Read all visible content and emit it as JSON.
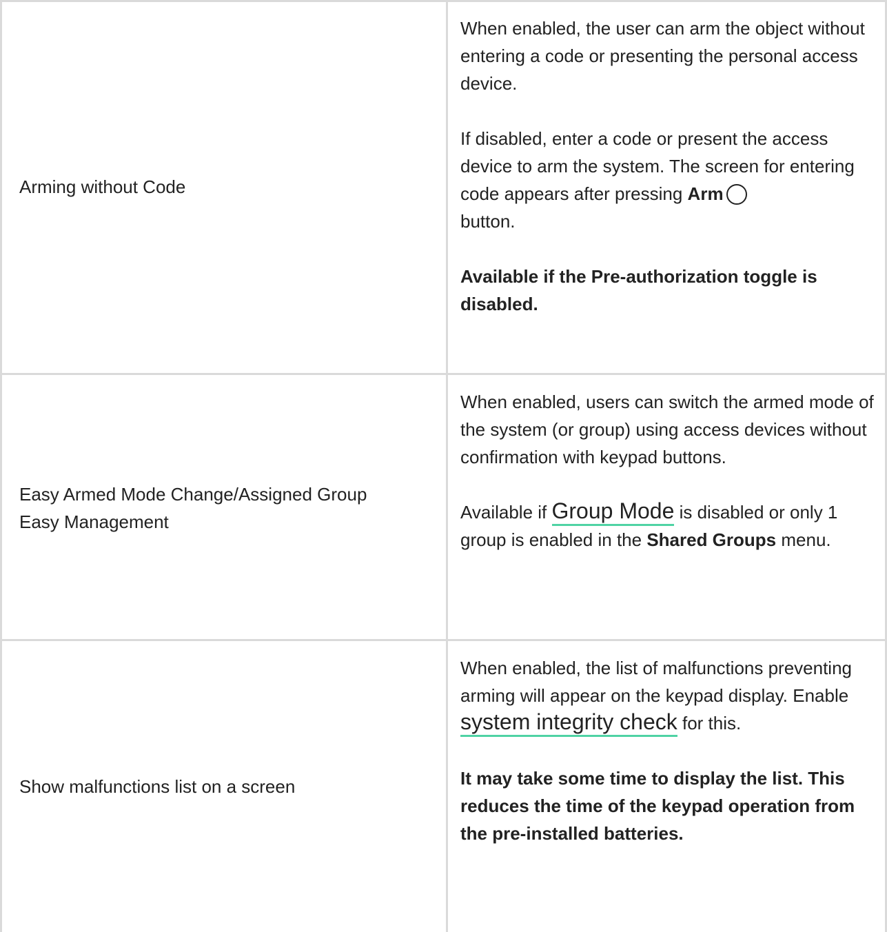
{
  "rows": [
    {
      "setting": "Arming without Code",
      "paragraphs": [
        "When enabled, the user can arm the object without entering a code or presenting the personal access device.",
        {
          "before": "If disabled, enter a code or present the access device to arm the system. The screen for entering code appears after pressing ",
          "bold": "Arm",
          "icon": "circle-icon",
          "after": "button."
        },
        {
          "bold": "Available if the Pre-authorization toggle is disabled."
        }
      ]
    },
    {
      "setting_line1": "Easy Armed Mode Change/Assigned Group",
      "setting_line2": "Easy Management",
      "paragraphs": [
        "When enabled, users can switch the armed mode of the system (or group) using access devices without confirmation with keypad buttons.",
        {
          "before": "Available if ",
          "link": "Group Mode",
          "middle": " is disabled or only 1 group is enabled in the ",
          "bold": "Shared Groups",
          "after": " menu."
        }
      ]
    },
    {
      "setting": "Show malfunctions list on a screen",
      "paragraphs": [
        {
          "before": "When enabled, the list of malfunctions preventing arming will appear on the keypad display. Enable ",
          "link": "system integrity check",
          "after": " for this."
        },
        {
          "bold": "It may take some time to display the list. This reduces the time of the keypad operation from the pre-installed batteries."
        }
      ]
    }
  ],
  "colors": {
    "border": "#dadada",
    "text": "#222222",
    "link_underline": "#4fd3a4"
  }
}
